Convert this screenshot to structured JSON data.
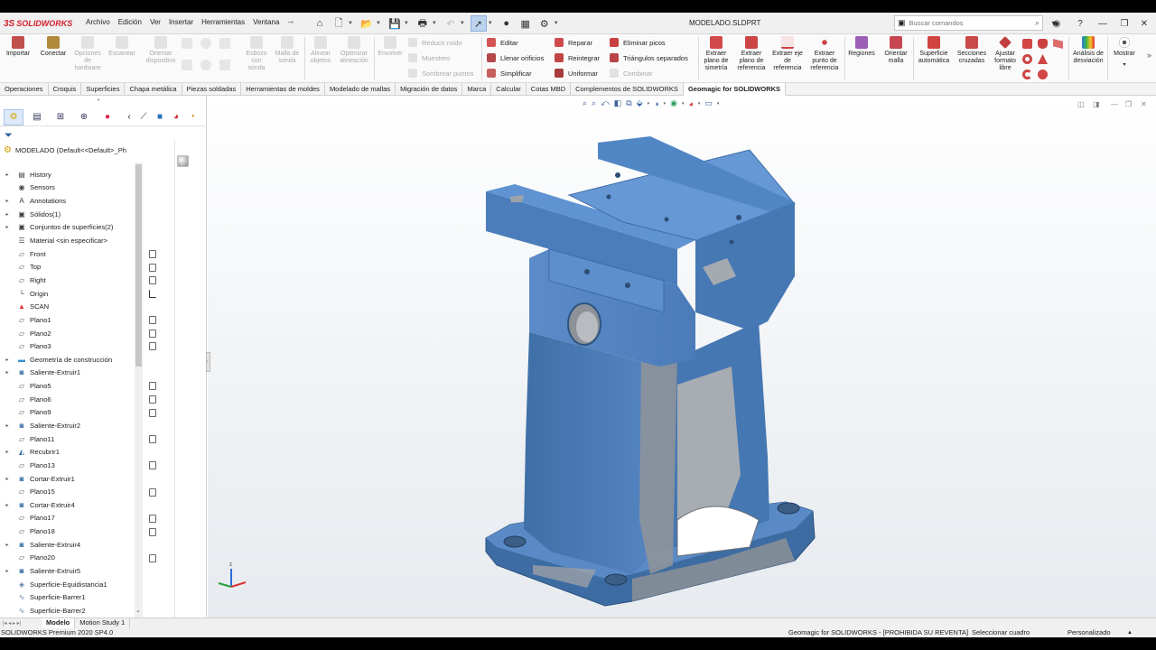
{
  "app": {
    "brand": "SOLIDWORKS",
    "document_title": "MODELADO.SLDPRT"
  },
  "menu": [
    "Archivo",
    "Edición",
    "Ver",
    "Insertar",
    "Herramientas",
    "Ventana"
  ],
  "search": {
    "placeholder": "Buscar comandos"
  },
  "commands": {
    "large": [
      {
        "label": "Importar",
        "enabled": true,
        "color": "#c0504d"
      },
      {
        "label": "Conectar",
        "enabled": true,
        "color": "#b08a3a"
      },
      {
        "label": "Opciones de hardware",
        "enabled": false
      },
      {
        "label": "Escanear",
        "enabled": false
      },
      {
        "label": "Orientar dispositivo",
        "enabled": false
      },
      {
        "label": "Esbozo con sonda",
        "enabled": false
      },
      {
        "label": "Malla de sonda",
        "enabled": false
      },
      {
        "label": "Alinear objetos",
        "enabled": false
      },
      {
        "label": "Optimizar alineación",
        "enabled": false
      },
      {
        "label": "Envolver",
        "enabled": false
      }
    ],
    "mesh_small_col1": [
      {
        "label": "Reducir ruido",
        "enabled": false
      },
      {
        "label": "Muestreo",
        "enabled": false
      },
      {
        "label": "Sombrear puntos",
        "enabled": false
      }
    ],
    "mesh_small_col2": [
      {
        "label": "Editar",
        "enabled": true
      },
      {
        "label": "Llenar orificios",
        "enabled": true
      },
      {
        "label": "Simplificar",
        "enabled": true
      }
    ],
    "mesh_small_col3": [
      {
        "label": "Reparar",
        "enabled": true
      },
      {
        "label": "Reintegrar",
        "enabled": true
      },
      {
        "label": "Uniformar",
        "enabled": true
      }
    ],
    "mesh_small_col4": [
      {
        "label": "Eliminar picos",
        "enabled": true
      },
      {
        "label": "Triángulos separados",
        "enabled": true
      },
      {
        "label": "Combinar",
        "enabled": false
      }
    ],
    "reference": [
      "Extraer plano de simetría",
      "Extraer plano de referencia",
      "Extraer eje de referencia",
      "Extraer punto de referencia"
    ],
    "regions": [
      "Regiones",
      "Orientar malla"
    ],
    "surfaces": [
      "Superficie automática",
      "Secciones cruzadas",
      "Ajustar formato libre"
    ],
    "analysis": "Análisis de desviación",
    "show": "Mostrar"
  },
  "tabs": [
    "Operaciones",
    "Croquis",
    "Superficies",
    "Chapa metálica",
    "Piezas soldadas",
    "Herramientas de moldes",
    "Modelado de mallas",
    "Migración de datos",
    "Marca",
    "Calcular",
    "Cotas MBD",
    "Complementos de SOLIDWORKS",
    "Geomagic for SOLIDWORKS"
  ],
  "active_tab": "Geomagic for SOLIDWORKS",
  "feature_tree": {
    "root": "MODELADO  (Default<<Default>_Ph",
    "items": [
      {
        "label": "History",
        "exp": true,
        "icon": "history-icon",
        "glyph": "▤"
      },
      {
        "label": "Sensors",
        "exp": false,
        "icon": "sensor-icon",
        "glyph": "◉"
      },
      {
        "label": "Annotations",
        "exp": true,
        "icon": "annotation-icon",
        "glyph": "A"
      },
      {
        "label": "Sólidos(1)",
        "exp": true,
        "icon": "solid-bodies-icon",
        "glyph": "▣"
      },
      {
        "label": "Conjuntos de superficies(2)",
        "exp": true,
        "icon": "surface-bodies-icon",
        "glyph": "▣"
      },
      {
        "label": "Material <sin especificar>",
        "exp": false,
        "icon": "material-icon",
        "glyph": "☰"
      },
      {
        "label": "Front",
        "exp": false,
        "icon": "plane-icon",
        "glyph": "▱"
      },
      {
        "label": "Top",
        "exp": false,
        "icon": "plane-icon",
        "glyph": "▱"
      },
      {
        "label": "Right",
        "exp": false,
        "icon": "plane-icon",
        "glyph": "▱"
      },
      {
        "label": "Origin",
        "exp": false,
        "icon": "origin-icon",
        "glyph": "└"
      },
      {
        "label": "SCAN",
        "exp": false,
        "icon": "scan-mesh-icon",
        "glyph": "▲"
      },
      {
        "label": "Plano1",
        "exp": false,
        "icon": "plane-icon",
        "glyph": "▱"
      },
      {
        "label": "Plano2",
        "exp": false,
        "icon": "plane-icon",
        "glyph": "▱"
      },
      {
        "label": "Plano3",
        "exp": false,
        "icon": "plane-icon",
        "glyph": "▱"
      },
      {
        "label": "Geometría de construcción",
        "exp": true,
        "icon": "folder-icon",
        "glyph": "▬"
      },
      {
        "label": "Saliente-Extruir1",
        "exp": true,
        "icon": "extrude-icon",
        "glyph": "◙"
      },
      {
        "label": "Plano5",
        "exp": false,
        "icon": "plane-icon",
        "glyph": "▱"
      },
      {
        "label": "Plano6",
        "exp": false,
        "icon": "plane-icon",
        "glyph": "▱"
      },
      {
        "label": "Plano9",
        "exp": false,
        "icon": "plane-icon",
        "glyph": "▱"
      },
      {
        "label": "Saliente-Extruir2",
        "exp": true,
        "icon": "extrude-icon",
        "glyph": "◙"
      },
      {
        "label": "Plano11",
        "exp": false,
        "icon": "plane-icon",
        "glyph": "▱"
      },
      {
        "label": "Recubrir1",
        "exp": true,
        "icon": "loft-icon",
        "glyph": "◭"
      },
      {
        "label": "Plano13",
        "exp": false,
        "icon": "plane-icon",
        "glyph": "▱"
      },
      {
        "label": "Cortar-Extruir1",
        "exp": true,
        "icon": "cut-extrude-icon",
        "glyph": "◙"
      },
      {
        "label": "Plano15",
        "exp": false,
        "icon": "plane-icon",
        "glyph": "▱"
      },
      {
        "label": "Cortar-Extruir4",
        "exp": true,
        "icon": "cut-extrude-icon",
        "glyph": "◙"
      },
      {
        "label": "Plano17",
        "exp": false,
        "icon": "plane-icon",
        "glyph": "▱"
      },
      {
        "label": "Plano18",
        "exp": false,
        "icon": "plane-icon",
        "glyph": "▱"
      },
      {
        "label": "Saliente-Extruir4",
        "exp": true,
        "icon": "extrude-icon",
        "glyph": "◙"
      },
      {
        "label": "Plano20",
        "exp": false,
        "icon": "plane-icon",
        "glyph": "▱"
      },
      {
        "label": "Saliente-Extruir5",
        "exp": true,
        "icon": "extrude-icon",
        "glyph": "◙"
      },
      {
        "label": "Superficie-Equidistancia1",
        "exp": false,
        "icon": "offset-surface-icon",
        "glyph": "◈"
      },
      {
        "label": "Superficie-Barrer1",
        "exp": false,
        "icon": "sweep-surface-icon",
        "glyph": "∿"
      },
      {
        "label": "Superficie-Barrer2",
        "exp": false,
        "icon": "sweep-surface-icon",
        "glyph": "∿"
      }
    ]
  },
  "bottom_tabs": [
    "Modelo",
    "Motion Study 1"
  ],
  "status": {
    "left": "SOLIDWORKS Premium 2020 SP4.0",
    "mid": "Geomagic for SOLIDWORKS - [PROHIBIDA SU REVENTA]",
    "select": "Seleccionar cuadro",
    "units": "Personalizado"
  },
  "colors": {
    "model_blue": "#4a7cb5",
    "model_gray": "#9a9ea3",
    "accent": "#d3202f"
  }
}
